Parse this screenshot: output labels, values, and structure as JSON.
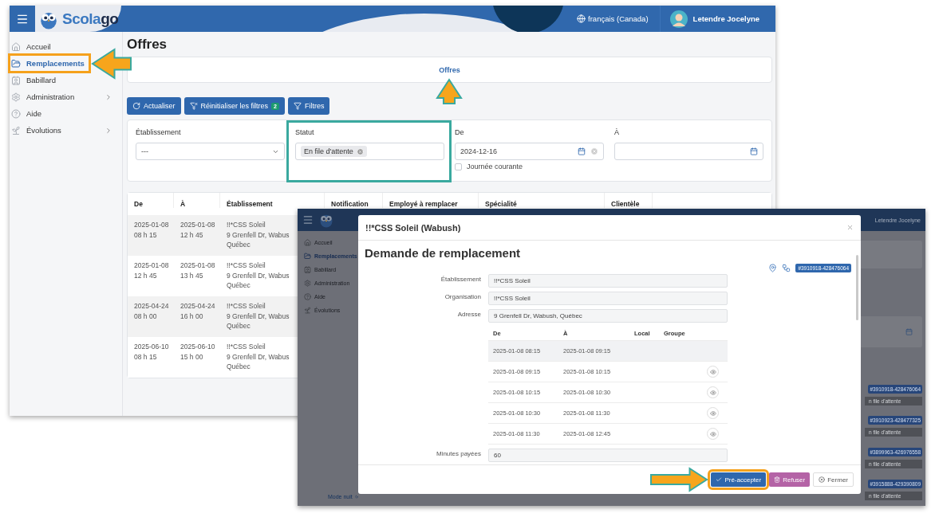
{
  "back_window": {
    "header": {
      "logo": "Scola**go**",
      "language": "français (Canada)",
      "user": "Letendre Jocelyne"
    },
    "sidebar": {
      "items": [
        {
          "label": "Accueil",
          "selected": false,
          "highlighted": false,
          "submenu": false
        },
        {
          "label": "Remplacements",
          "selected": true,
          "highlighted": true,
          "submenu": false
        },
        {
          "label": "Babillard",
          "selected": false,
          "highlighted": false,
          "submenu": false
        },
        {
          "label": "Administration",
          "selected": false,
          "highlighted": false,
          "submenu": true
        },
        {
          "label": "Aide",
          "selected": false,
          "highlighted": false,
          "submenu": false
        },
        {
          "label": "Évolutions",
          "selected": false,
          "highlighted": false,
          "submenu": true
        }
      ]
    },
    "page_title": "Offres",
    "breadcrumb": {
      "label": "Offres",
      "highlighted": true
    },
    "toolbar": [
      {
        "label": "Actualiser",
        "kind": "refresh"
      },
      {
        "label": "Réinitialiser les filtres",
        "kind": "reset",
        "badge": "2"
      },
      {
        "label": "Filtres",
        "kind": "filter"
      }
    ],
    "filters": [
      {
        "label": "Établissement",
        "kind": "select",
        "value": "---",
        "highlighted": false
      },
      {
        "label": "Statut",
        "kind": "tags",
        "tags": [
          "En file d'attente"
        ],
        "highlighted": true
      },
      {
        "label": "De",
        "kind": "date",
        "value": "2024-12-16",
        "clearable": true,
        "checkbox": {
          "label": "Journée courante",
          "checked": false
        },
        "highlighted": false
      },
      {
        "label": "À",
        "kind": "date",
        "highlighted": false
      }
    ],
    "table": {
      "columns": [
        "De",
        "À",
        "Établissement",
        "Notification",
        "Employé à remplacer",
        "Spécialité",
        "Clientèle"
      ],
      "rows": [
        {
          "cells": [
            [
              "2025-01-08",
              "08 h 15"
            ],
            [
              "2025-01-08",
              "12 h 45"
            ],
            [
              "!!*CSS Soleil",
              "9 Grenfell Dr, Wabus",
              "Québec"
            ]
          ]
        },
        {
          "cells": [
            [
              "2025-01-08",
              "12 h 45"
            ],
            [
              "2025-01-08",
              "13 h 45"
            ],
            [
              "!!*CSS Soleil",
              "9 Grenfell Dr, Wabus",
              "Québec"
            ]
          ]
        },
        {
          "cells": [
            [
              "2025-04-24",
              "08 h 00"
            ],
            [
              "2025-04-24",
              "16 h 00"
            ],
            [
              "!!*CSS Soleil",
              "9 Grenfell Dr, Wabus",
              "Québec"
            ]
          ]
        },
        {
          "cells": [
            [
              "2025-06-10",
              "08 h 15"
            ],
            [
              "2025-06-10",
              "15 h 00"
            ],
            [
              "!!*CSS Soleil",
              "9 Grenfell Dr, Wabus",
              "Québec"
            ]
          ]
        }
      ]
    }
  },
  "front_window": {
    "user": "Letendre Jocelyne",
    "sidebar": {
      "items": [
        {
          "label": "Accueil",
          "selected": false
        },
        {
          "label": "Remplacements",
          "selected": true
        },
        {
          "label": "Babillard",
          "selected": false
        },
        {
          "label": "Administration",
          "selected": false
        },
        {
          "label": "Aide",
          "selected": false
        },
        {
          "label": "Évolutions",
          "selected": false
        }
      ],
      "footer": "Mode nuit"
    },
    "rows": [
      {
        "id": "#3910918-428476064",
        "status": "n file d'attente"
      },
      {
        "id": "#3910923-428477325",
        "status": "n file d'attente"
      },
      {
        "id": "#3899963-426976558",
        "status": "n file d'attente"
      },
      {
        "id": "#3915888-429390809",
        "status": "n file d'attente"
      }
    ],
    "modal": {
      "title": "!!*CSS Soleil (Wabush)",
      "heading": "Demande de remplacement",
      "id_badge": "#3910918-428476064",
      "fields": [
        {
          "label": "Établissement",
          "value": "!!*CSS Soleil"
        },
        {
          "label": "Organisation",
          "value": "!!*CSS Soleil"
        },
        {
          "label": "Adresse",
          "value": "9 Grenfell Dr, Wabush, Québec"
        }
      ],
      "slots": {
        "columns": [
          "De",
          "À",
          "Local",
          "Groupe"
        ],
        "rows": [
          {
            "from": "2025-01-08 08:15",
            "to": "2025-01-08 09:15",
            "selected": true,
            "viewable": false
          },
          {
            "from": "2025-01-08 09:15",
            "to": "2025-01-08 10:15",
            "selected": false,
            "viewable": true
          },
          {
            "from": "2025-01-08 10:15",
            "to": "2025-01-08 10:30",
            "selected": false,
            "viewable": true
          },
          {
            "from": "2025-01-08 10:30",
            "to": "2025-01-08 11:30",
            "selected": false,
            "viewable": true
          },
          {
            "from": "2025-01-08 11:30",
            "to": "2025-01-08 12:45",
            "selected": false,
            "viewable": true
          }
        ]
      },
      "paid_minutes": {
        "label": "Minutes payées",
        "value": "60"
      },
      "buttons": [
        {
          "label": "Pré-accepter",
          "kind": "primary",
          "highlighted": true
        },
        {
          "label": "Refuser",
          "kind": "danger",
          "highlighted": false
        },
        {
          "label": "Fermer",
          "kind": "default",
          "highlighted": false
        }
      ]
    }
  }
}
